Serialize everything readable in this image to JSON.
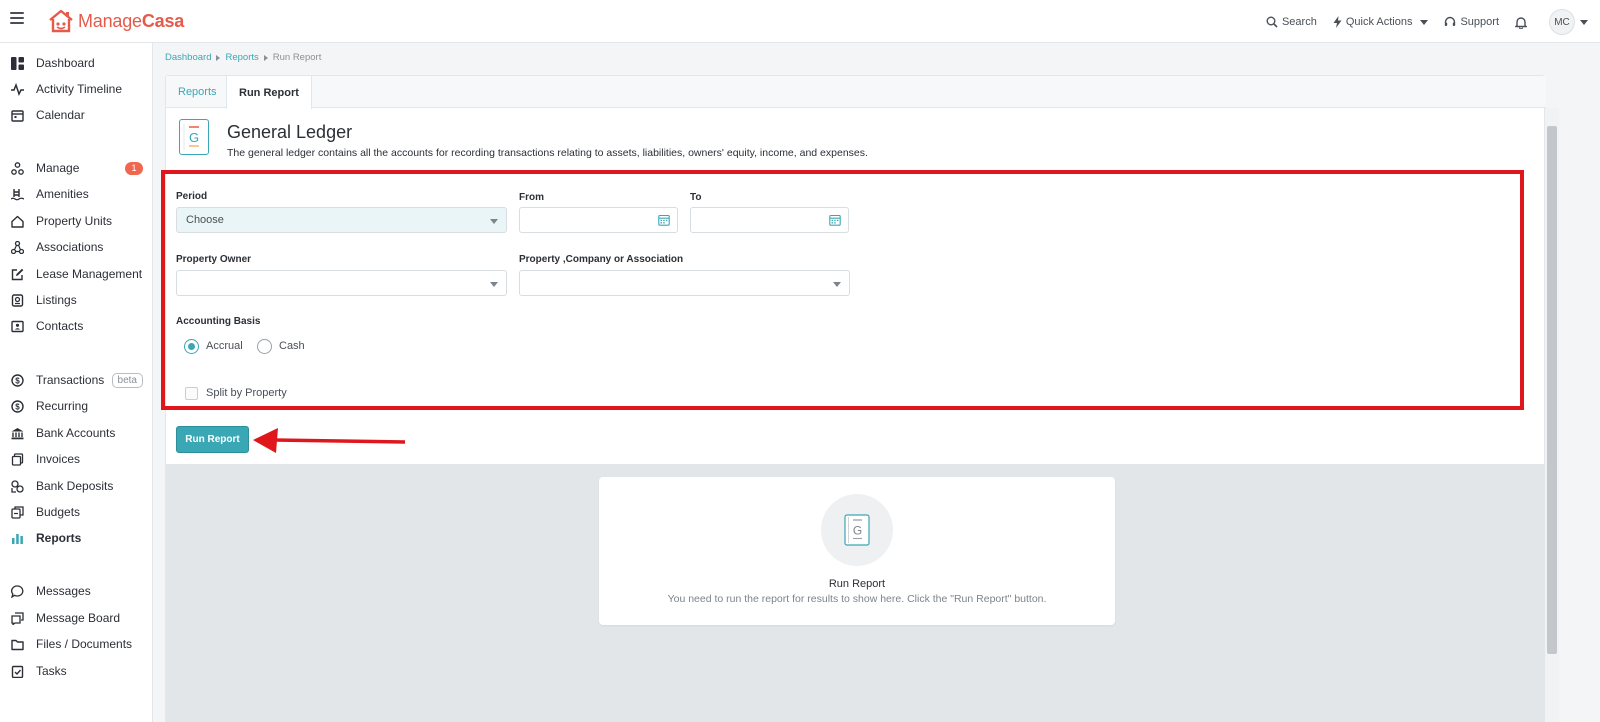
{
  "topbar": {
    "logo_text_light": "Manage",
    "logo_text_bold": "Casa",
    "search_label": "Search",
    "quick_actions_label": "Quick Actions",
    "support_label": "Support",
    "avatar_initials": "MC"
  },
  "sidebar": {
    "items": [
      {
        "label": "Dashboard",
        "icon": "dashboard-icon"
      },
      {
        "label": "Activity Timeline",
        "icon": "pulse-icon"
      },
      {
        "label": "Calendar",
        "icon": "calendar-icon"
      },
      {
        "label": "Manage",
        "icon": "manage-icon",
        "badge": "1"
      },
      {
        "label": "Amenities",
        "icon": "pool-icon"
      },
      {
        "label": "Property Units",
        "icon": "home-icon"
      },
      {
        "label": "Associations",
        "icon": "network-icon"
      },
      {
        "label": "Lease Management",
        "icon": "edit-icon"
      },
      {
        "label": "Listings",
        "icon": "listing-icon"
      },
      {
        "label": "Contacts",
        "icon": "contact-card-icon"
      },
      {
        "label": "Transactions",
        "icon": "dollar-circle-icon",
        "badge": "beta"
      },
      {
        "label": "Recurring",
        "icon": "dollar-circle-icon"
      },
      {
        "label": "Bank Accounts",
        "icon": "bank-icon"
      },
      {
        "label": "Invoices",
        "icon": "invoice-icon"
      },
      {
        "label": "Bank Deposits",
        "icon": "deposit-icon"
      },
      {
        "label": "Budgets",
        "icon": "budget-icon"
      },
      {
        "label": "Reports",
        "icon": "bar-chart-icon",
        "active": true
      },
      {
        "label": "Messages",
        "icon": "chat-icon"
      },
      {
        "label": "Message Board",
        "icon": "board-icon"
      },
      {
        "label": "Files / Documents",
        "icon": "folder-icon"
      },
      {
        "label": "Tasks",
        "icon": "task-icon"
      }
    ]
  },
  "breadcrumb": {
    "items": [
      "Dashboard",
      "Reports",
      "Run Report"
    ]
  },
  "tabs": [
    "Reports",
    "Run Report"
  ],
  "report": {
    "icon_letter": "G",
    "title": "General Ledger",
    "description": "The general ledger contains all the accounts for recording transactions relating to assets, liabilities, owners' equity, income, and expenses."
  },
  "form": {
    "period_label": "Period",
    "period_value": "Choose",
    "from_label": "From",
    "to_label": "To",
    "property_owner_label": "Property Owner",
    "property_company_label": "Property ,Company or Association",
    "accounting_basis_label": "Accounting Basis",
    "accrual_label": "Accrual",
    "cash_label": "Cash",
    "accounting_basis_selected": "Accrual",
    "split_by_property_label": "Split by Property",
    "split_by_property_checked": false,
    "run_button_label": "Run Report"
  },
  "empty_state": {
    "icon_letter": "G",
    "title": "Run Report",
    "description": "You need to run the report for results to show here. Click the \"Run Report\" button."
  },
  "colors": {
    "brand": "#e55a4a",
    "accent": "#3aa7b5",
    "annotation": "#e0161d"
  }
}
